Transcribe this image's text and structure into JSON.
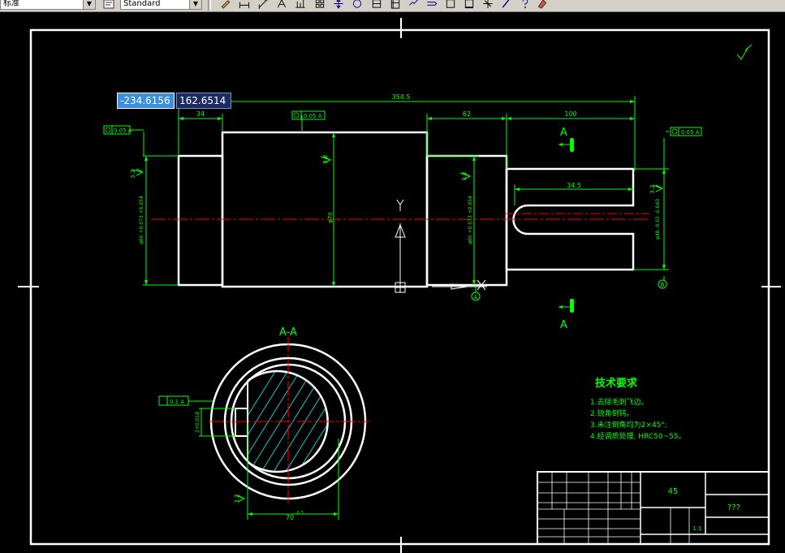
{
  "toolbar": {
    "dimstyle_value": "标准",
    "textstyle_value": "Standard",
    "icons": [
      "pencil-icon",
      "linear-dimension-icon",
      "aligned-dimension-icon",
      "ordinate-dimension-icon",
      "baseline-dimension-icon",
      "continue-dimension-icon",
      "radius-dimension-icon",
      "center-mark-icon",
      "tolerance-icon",
      "quick-leader-icon",
      "dimension-edit-icon",
      "text-edit-icon",
      "box-icon",
      "box2-icon",
      "snap-icon",
      "pen-icon",
      "help-icon",
      "erase-icon"
    ]
  },
  "coordinates": {
    "x": "-234.6156",
    "y": "162.6514"
  },
  "drawing": {
    "colors": {
      "background": "#000000",
      "outline": "#ffffff",
      "dimension": "#00ff00",
      "centerline": "#ff0000",
      "hatch": "#00ffff",
      "ucs": "#ffffff"
    },
    "dims": {
      "overall_length": "354.5",
      "left_step": "34",
      "mid_step": "62",
      "right_len": "100",
      "keyway_len": "34.5",
      "diameter_main": "φ70",
      "section_width": "70",
      "section_width_tol": "-0.3"
    },
    "dim_left_d": "φ60 +0.073 +0.054",
    "dim_mid_d": "φ60 +0.073 +0.054",
    "dim_right_d": "φ48 -0.02 -0.043",
    "dim_section_key": "2+0.018",
    "tolerances": {
      "left": "0.05 A",
      "center": "0.05 A",
      "right": "0.05 A",
      "section": "0.1 A"
    },
    "roughness": {
      "left": "3.2",
      "center": "3.2",
      "mid": "3.2",
      "right": "3.2",
      "section": "3.2"
    },
    "section_marks": {
      "top": "A",
      "bottom": "A"
    },
    "datum_labels": {
      "a": "A",
      "b": "B"
    },
    "section_title": "A-A",
    "ucs_label": "Y"
  },
  "tech": {
    "title": "技术要求",
    "items": [
      "1.去除毛刺飞边。",
      "2.锐角倒钝。",
      "3.未注倒角均为2×45°;",
      "4.经调质处理, HRC50~55。"
    ]
  },
  "titleblock": {
    "material": "45",
    "name": "???",
    "scale": "1:1"
  }
}
